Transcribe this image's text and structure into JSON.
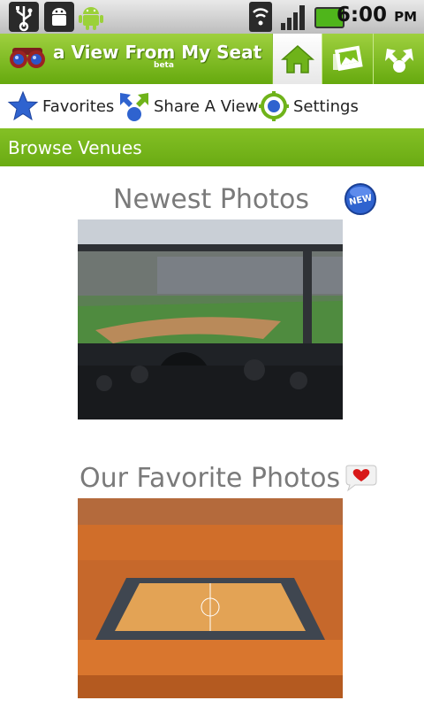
{
  "status_bar": {
    "time": "6:00",
    "ampm": "PM",
    "icons": [
      "usb-icon",
      "android-debug-icon",
      "android-mascot-icon",
      "wifi-icon",
      "signal-icon",
      "battery-icon"
    ]
  },
  "header": {
    "app_title": "a View From My Seat",
    "beta_label": "beta",
    "tabs": [
      "home-icon",
      "photos-icon",
      "share-icon"
    ],
    "accent_color": "#7cbf1e"
  },
  "quick_nav": [
    {
      "label": "Favorites",
      "icon": "star-icon"
    },
    {
      "label": "Share A View",
      "icon": "share-view-icon"
    },
    {
      "label": "Settings",
      "icon": "settings-icon"
    }
  ],
  "browse": {
    "label": "Browse Venues"
  },
  "sections": {
    "newest": {
      "title": "Newest Photos",
      "badge_icon": "new-badge-icon"
    },
    "favorite": {
      "title": "Our Favorite Photos",
      "badge_icon": "heart-badge-icon"
    }
  }
}
